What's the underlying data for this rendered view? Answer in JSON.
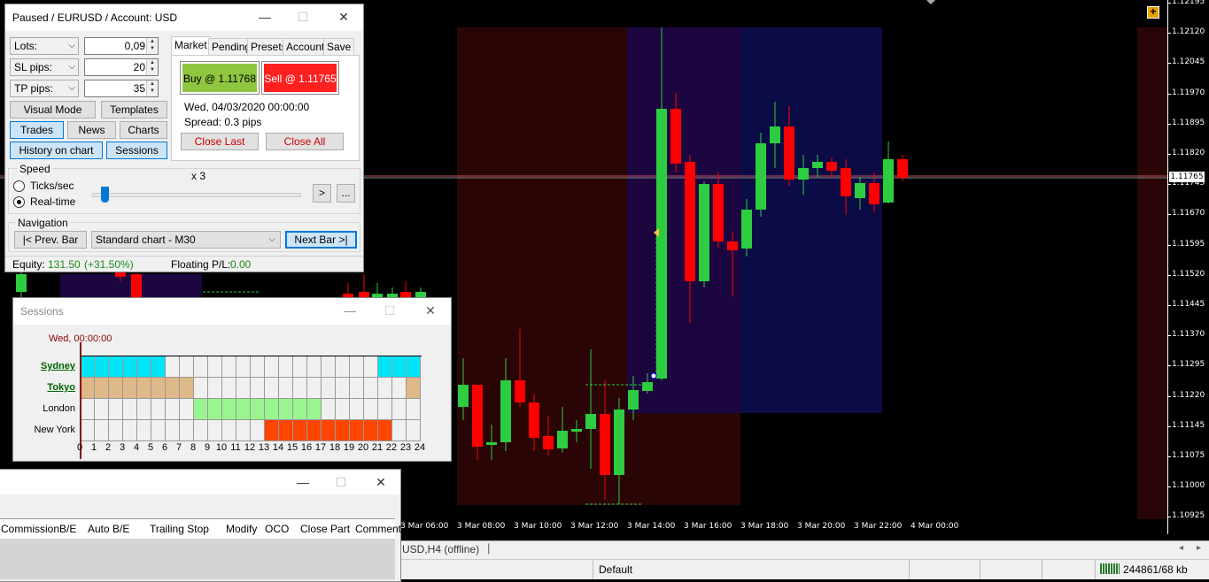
{
  "chart": {
    "price_ticks": [
      "1.12195",
      "1.12120",
      "1.12045",
      "1.11970",
      "1.11895",
      "1.11820",
      "1.11745",
      "1.11670",
      "1.11595",
      "1.11520",
      "1.11445",
      "1.11370",
      "1.11295",
      "1.11220",
      "1.11145",
      "1.11075",
      "1.11000",
      "1.10925"
    ],
    "current_price": "1.11765",
    "time_ticks": [
      "3 Mar 06:00",
      "3 Mar 08:00",
      "3 Mar 10:00",
      "3 Mar 12:00",
      "3 Mar 14:00",
      "3 Mar 16:00",
      "3 Mar 18:00",
      "3 Mar 20:00",
      "3 Mar 22:00",
      "4 Mar 00:00"
    ],
    "colors": {
      "bull": "#2ecc40",
      "bear": "#ff0000",
      "asia_bg": "#2a0505",
      "london_bg": "#1c0640",
      "ny_bg": "#0b0b45"
    }
  },
  "sim_window": {
    "title": "Paused / EURUSD / Account: USD",
    "lots_label": "Lots:",
    "lots_value": "0,09",
    "sl_label": "SL pips:",
    "sl_value": "20",
    "tp_label": "TP pips:",
    "tp_value": "35",
    "visual_mode": "Visual Mode",
    "templates": "Templates",
    "trades": "Trades",
    "news": "News",
    "charts": "Charts",
    "history_on_chart": "History on chart",
    "sessions": "Sessions",
    "tabs": [
      "Market",
      "Pending",
      "Presets",
      "Account",
      "Save"
    ],
    "buy": "Buy @ 1.11768",
    "sell": "Sell @ 1.11765",
    "datetime": "Wed, 04/03/2020  00:00:00",
    "spread": "Spread: 0.3 pips",
    "close_last": "Close Last",
    "close_all": "Close All",
    "speed_label": "Speed",
    "speed_multiplier": "x 3",
    "ticks_sec": "Ticks/sec",
    "real_time": "Real-time",
    "play": ">",
    "more": "...",
    "navigation_label": "Navigation",
    "prev_bar": "|< Prev. Bar",
    "chart_select": "Standard chart - M30",
    "next_bar": "Next Bar >|",
    "equity_label": "Equity:",
    "equity_value": "131.50",
    "equity_pct": "(+31.50%)",
    "floating_label": "Floating P/L:",
    "floating_value": "0.00"
  },
  "sessions_window": {
    "title": "Sessions",
    "current_time": "Wed, 00:00:00",
    "rows": [
      {
        "name": "Sydney",
        "color": "#00e5f5",
        "active": [
          0,
          1,
          2,
          3,
          4,
          5,
          21,
          22,
          23
        ]
      },
      {
        "name": "Tokyo",
        "color": "#deb887",
        "active": [
          0,
          1,
          2,
          3,
          4,
          5,
          6,
          7,
          23
        ]
      },
      {
        "name": "London",
        "color": "#9af58f",
        "active": [
          8,
          9,
          10,
          11,
          12,
          13,
          14,
          15,
          16
        ]
      },
      {
        "name": "New York",
        "color": "#ff4500",
        "active": [
          13,
          14,
          15,
          16,
          17,
          18,
          19,
          20,
          21
        ]
      }
    ],
    "hours": [
      "0",
      "1",
      "2",
      "3",
      "4",
      "5",
      "6",
      "7",
      "8",
      "9",
      "10",
      "11",
      "12",
      "13",
      "14",
      "15",
      "16",
      "17",
      "18",
      "19",
      "20",
      "21",
      "22",
      "23",
      "24"
    ]
  },
  "terminal_window": {
    "columns": [
      "Commission",
      "B/E",
      "Auto B/E",
      "Trailing Stop",
      "Modify",
      "OCO",
      "Close Part",
      "Comment"
    ]
  },
  "status_bar": {
    "chart_tab": "USD,H4 (offline)",
    "profile": "Default",
    "traffic": "244861/68 kb"
  }
}
